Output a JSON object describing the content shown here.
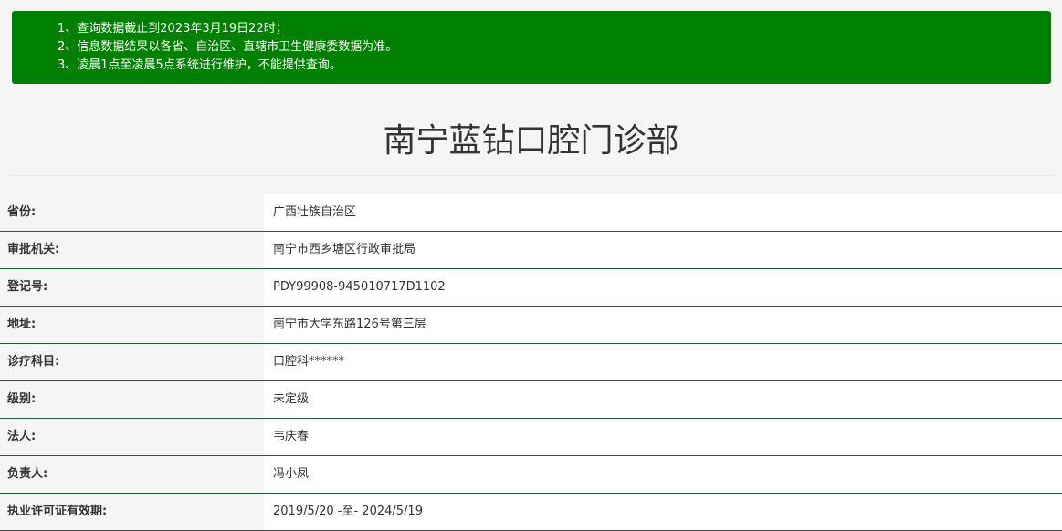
{
  "notice": {
    "lines": [
      "1、查询数据截止到2023年3月19日22时；",
      "2、信息数据结果以各省、自治区、直辖市卫生健康委数据为准。",
      "3、凌晨1点至凌晨5点系统进行维护，不能提供查询。"
    ],
    "bg_color": "#008000"
  },
  "page": {
    "title": "南宁蓝钻口腔门诊部"
  },
  "info": {
    "rows": [
      {
        "label": "省份:",
        "value": "广西壮族自治区"
      },
      {
        "label": "审批机关:",
        "value": "南宁市西乡塘区行政审批局"
      },
      {
        "label": "登记号:",
        "value": "PDY99908-945010717D1102"
      },
      {
        "label": "地址:",
        "value": "南宁市大学东路126号第三层"
      },
      {
        "label": "诊疗科目:",
        "value": "口腔科******"
      },
      {
        "label": "级别:",
        "value": "未定级"
      },
      {
        "label": "法人:",
        "value": "韦庆春"
      },
      {
        "label": "负责人:",
        "value": "冯小凤"
      },
      {
        "label": "执业许可证有效期:",
        "value": "2019/5/20 -至- 2024/5/19"
      }
    ],
    "border_color": "#1f5b3c"
  }
}
